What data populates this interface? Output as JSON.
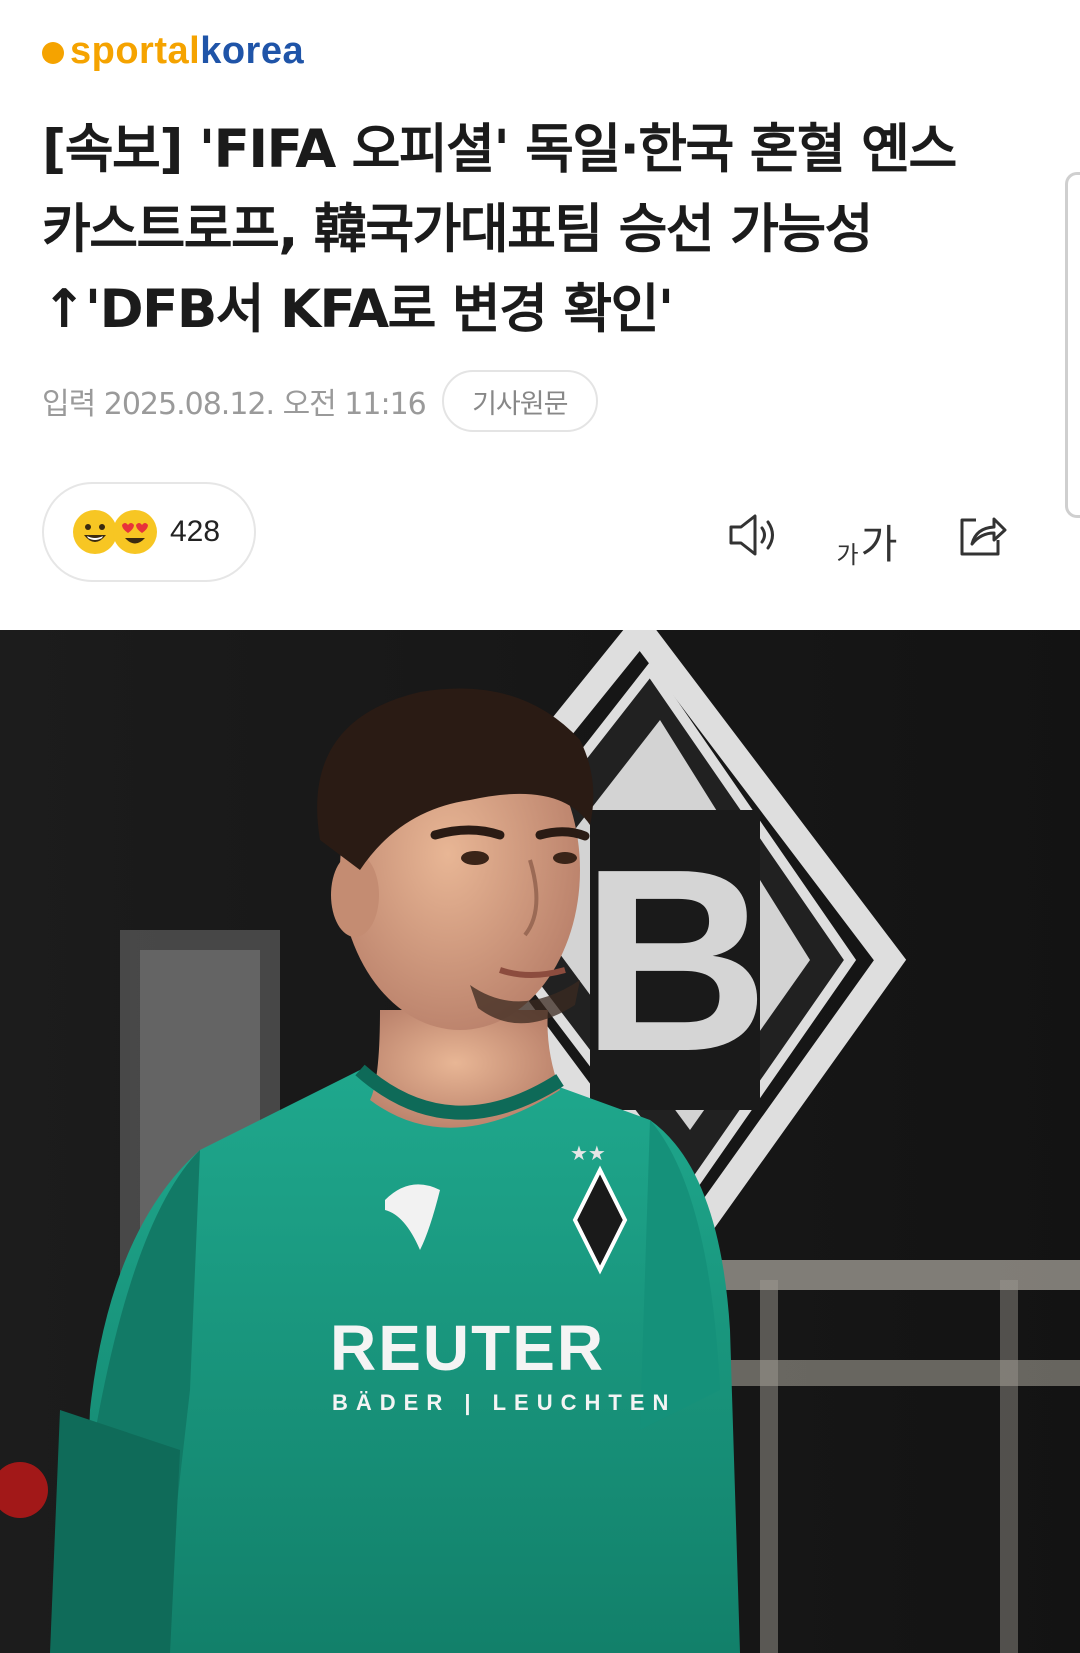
{
  "brand": {
    "part1": "sportal",
    "part2": "korea",
    "accent_orange": "#f5a300",
    "accent_blue": "#1f54a8"
  },
  "article": {
    "headline_line1": "[속보] 'FIFA 오피셜' 독일·한국 혼혈 옌스",
    "headline_line2": "카스트로프, 韓국가대표팀 승선 가능성",
    "headline_line3": "↑'DFB서 KFA로 변경 확인'",
    "date": "입력 2025.08.12. 오전 11:16",
    "source_button": "기사원문"
  },
  "reactions": {
    "count": "428",
    "icons": [
      "grinning-face-icon",
      "heart-eyes-face-icon"
    ]
  },
  "toolbar": {
    "icons": [
      "speaker-icon",
      "font-size-icon",
      "share-icon"
    ],
    "font_small": "가",
    "font_large": "가"
  },
  "photo": {
    "jersey_sponsor": "REUTER",
    "jersey_sub": "BÄDER | LEUCHTEN",
    "crest_letter": "B"
  }
}
